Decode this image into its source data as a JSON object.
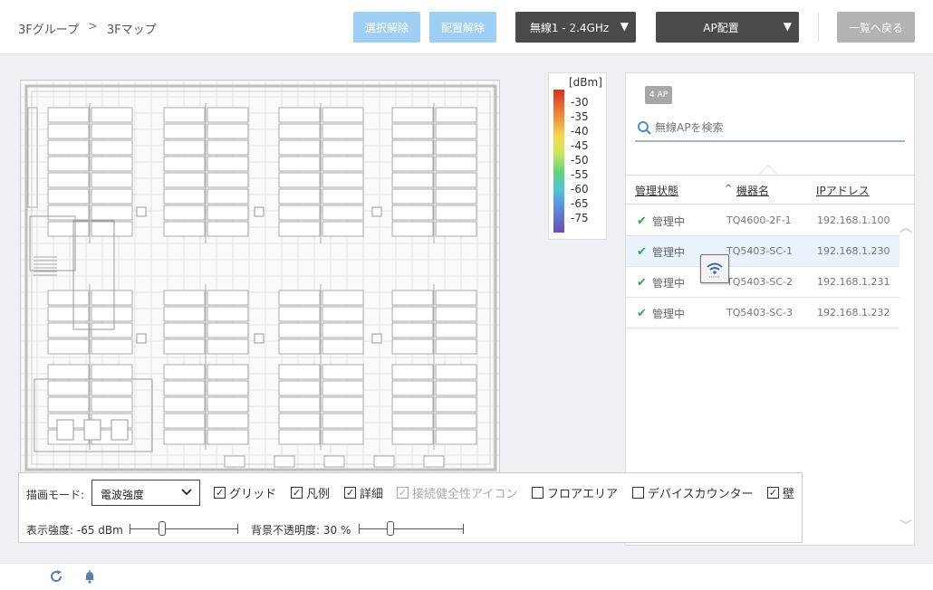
{
  "header": {
    "breadcrumb": [
      "3Fグループ",
      ">",
      "3Fマップ"
    ],
    "deselect_label": "選択解除",
    "unplace_label": "配置解除",
    "radio_select": "無線1 - 2.4GHz",
    "ap_place_select": "AP配置",
    "back_label": "一覧へ戻る"
  },
  "legend": {
    "unit": "[dBm]",
    "ticks": [
      "-30",
      "-35",
      "-40",
      "-45",
      "-50",
      "-55",
      "-60",
      "-65",
      "-75"
    ]
  },
  "ap_panel": {
    "count_badge": "4 AP",
    "search_placeholder": "無線APを検索",
    "columns": {
      "status": "管理状態",
      "sort_indicator": "^",
      "device": "機器名",
      "ip": "IPアドレス"
    },
    "rows": [
      {
        "status": "管理中",
        "device": "TQ4600-2F-1",
        "ip": "192.168.1.100"
      },
      {
        "status": "管理中",
        "device": "TQ5403-SC-1",
        "ip": "192.168.1.230"
      },
      {
        "status": "管理中",
        "device": "TQ5403-SC-2",
        "ip": "192.168.1.231"
      },
      {
        "status": "管理中",
        "device": "TQ5403-SC-3",
        "ip": "192.168.1.232"
      }
    ]
  },
  "controls": {
    "draw_mode_label": "描画モード:",
    "draw_mode_value": "電波強度",
    "checkboxes": [
      {
        "label": "グリッド",
        "checked": true,
        "disabled": false
      },
      {
        "label": "凡例",
        "checked": true,
        "disabled": false
      },
      {
        "label": "詳細",
        "checked": true,
        "disabled": false
      },
      {
        "label": "接続健全性アイコン",
        "checked": true,
        "disabled": true
      },
      {
        "label": "フロアエリア",
        "checked": false,
        "disabled": false
      },
      {
        "label": "デバイスカウンター",
        "checked": false,
        "disabled": false
      },
      {
        "label": "壁",
        "checked": true,
        "disabled": false
      }
    ],
    "strength_label": "表示強度: -65 dBm",
    "strength_level": 0.3,
    "opacity_label": "背景不透明度: 30 %",
    "opacity_level": 0.3
  },
  "colors": {
    "accent_light": "#9fcff5",
    "dark_button": "#4a4a4a",
    "status_ok": "#2fa84f"
  },
  "icons": [
    "search-icon",
    "check-icon",
    "wifi-icon",
    "refresh-icon",
    "bell-icon",
    "chevron-down-icon"
  ]
}
